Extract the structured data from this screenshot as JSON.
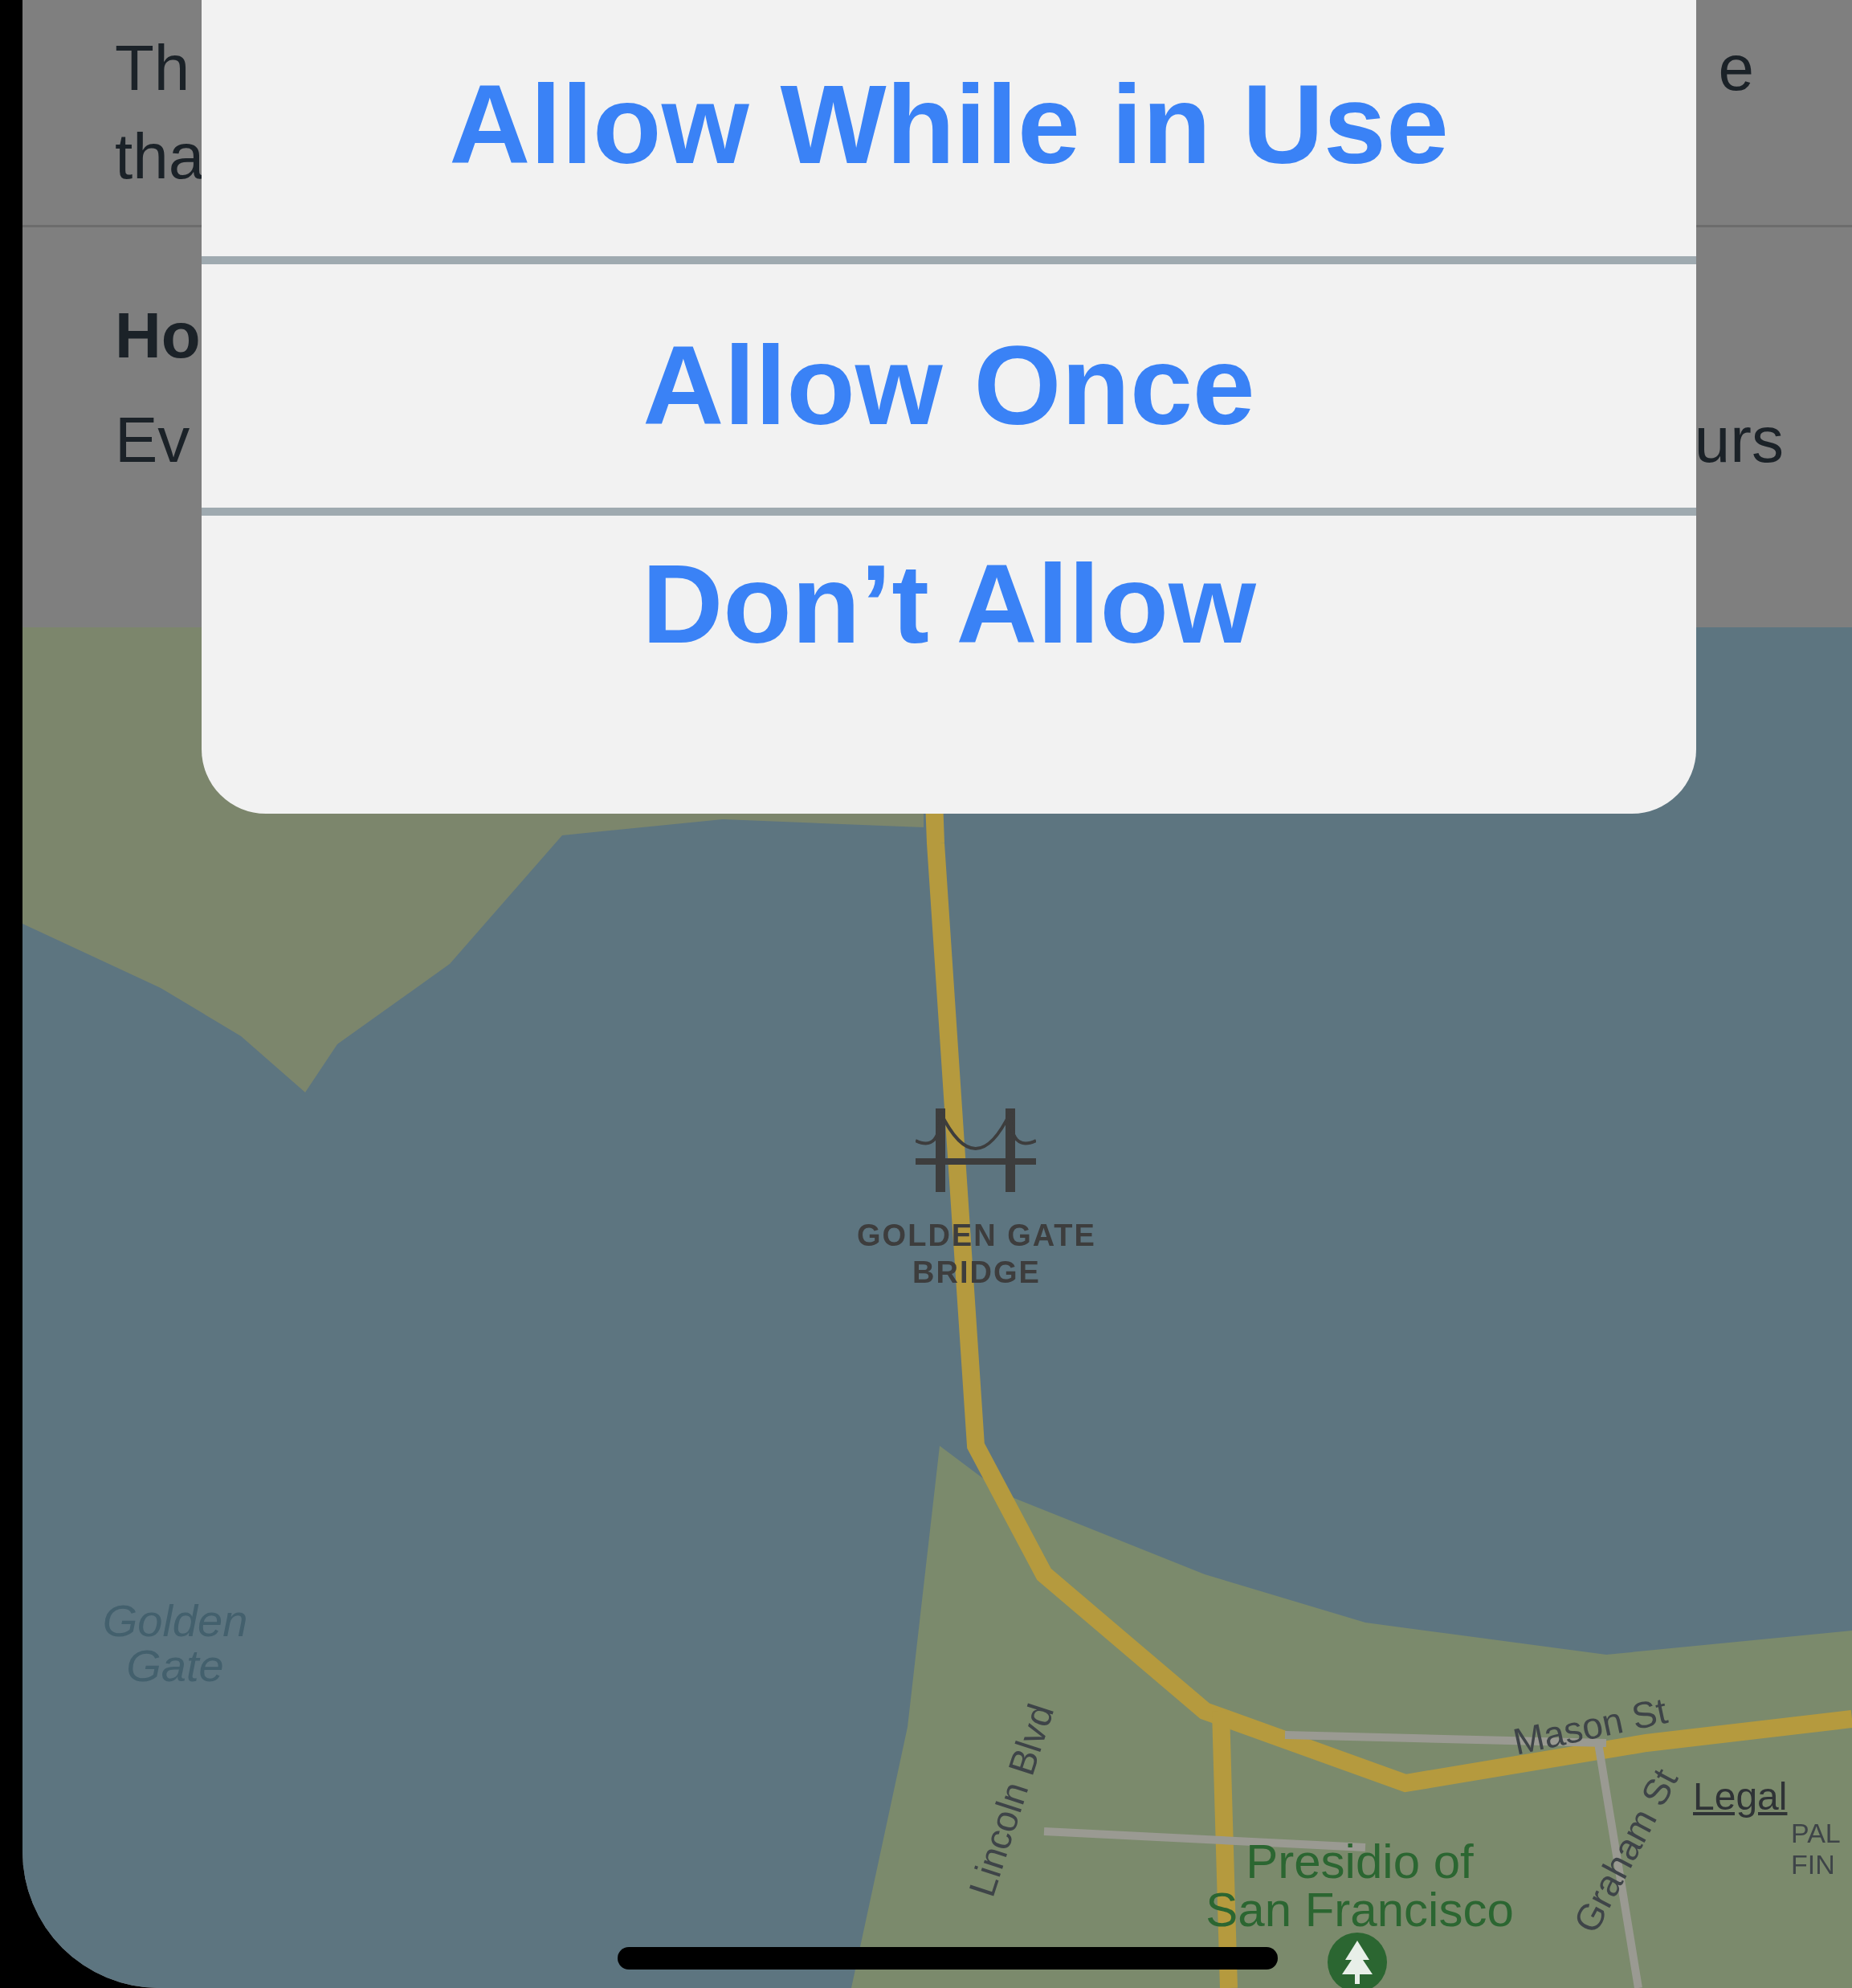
{
  "place": {
    "description": {
      "lines": [
        {
          "start": "Th",
          "end": "e"
        },
        {
          "start": "tha"
        }
      ]
    },
    "hours": {
      "title": "Ho",
      "rows": [
        {
          "day": "Ev",
          "time": "urs"
        }
      ]
    }
  },
  "alert": {
    "buttons": [
      {
        "label": "Allow While in Use"
      },
      {
        "label": "Allow Once"
      },
      {
        "label": "Don’t Allow"
      }
    ]
  },
  "map": {
    "labels": [
      {
        "kind": "landmark",
        "text": "GOLDEN GATE BRIDGE"
      },
      {
        "kind": "water",
        "text": "Golden Gate"
      },
      {
        "kind": "street",
        "text": "Lincoln Blvd"
      },
      {
        "kind": "street",
        "text": "Mason St"
      },
      {
        "kind": "street",
        "text": "Graham St"
      },
      {
        "kind": "park",
        "text": "Presidio of San Francisco"
      },
      {
        "kind": "district",
        "text": "PAL FIN"
      }
    ],
    "legal": "Legal"
  }
}
